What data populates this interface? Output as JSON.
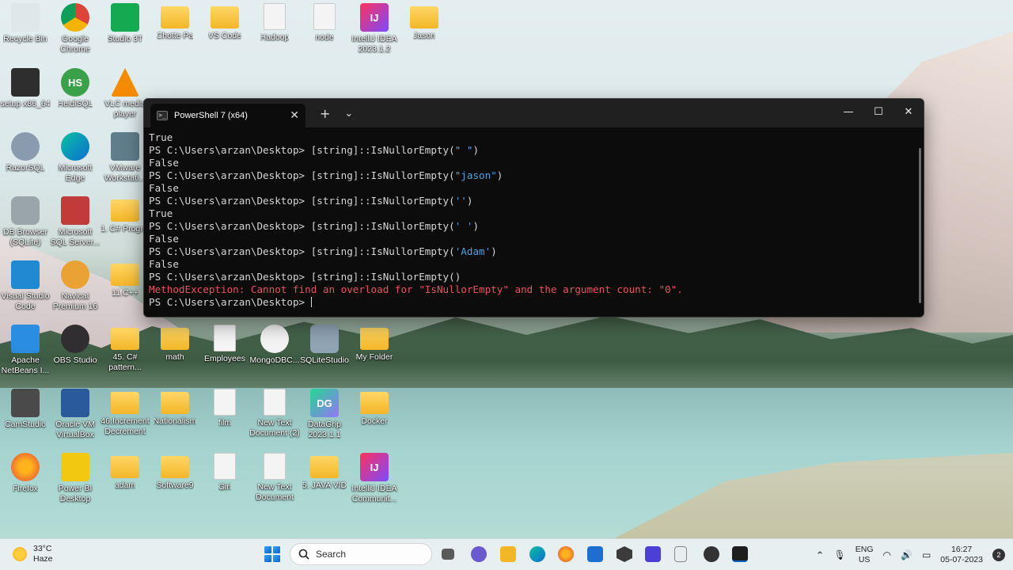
{
  "desktop": {
    "icons": [
      {
        "label": "Recycle Bin",
        "icon": "recycle-bin-icon"
      },
      {
        "label": "Google Chrome",
        "icon": "chrome-icon"
      },
      {
        "label": "Studio 3T",
        "icon": "studio3t-icon"
      },
      {
        "label": "Chotte Pa",
        "icon": "folder-icon"
      },
      {
        "label": "VS Code",
        "icon": "folder-icon"
      },
      {
        "label": "Hadoop",
        "icon": "document-icon"
      },
      {
        "label": "node",
        "icon": "document-icon"
      },
      {
        "label": "IntelliJ IDEA 2023.1.2",
        "icon": "intellij-icon"
      },
      {
        "label": "Jason",
        "icon": "folder-icon"
      },
      {
        "label": "setup x86_64",
        "icon": "setup-icon"
      },
      {
        "label": "HeidiSQL",
        "icon": "heidisql-icon"
      },
      {
        "label": "VLC media player",
        "icon": "vlc-icon"
      },
      {
        "label": "RazorSQL",
        "icon": "razorsql-icon"
      },
      {
        "label": "Microsoft Edge",
        "icon": "edge-icon"
      },
      {
        "label": "VMware Workstati...",
        "icon": "vmware-icon"
      },
      {
        "label": "DB Browser (SQLite)",
        "icon": "database-icon"
      },
      {
        "label": "Microsoft SQL Server...",
        "icon": "sqlserver-icon"
      },
      {
        "label": "1. C# Progr...",
        "icon": "folder-icon"
      },
      {
        "label": "Visual Studio Code",
        "icon": "vscode-icon"
      },
      {
        "label": "Navicat Premium 16",
        "icon": "navicat-icon"
      },
      {
        "label": "11.C++",
        "icon": "folder-icon"
      },
      {
        "label": "Apache NetBeans I...",
        "icon": "netbeans-icon"
      },
      {
        "label": "OBS Studio",
        "icon": "obs-icon"
      },
      {
        "label": "45. C# pattern...",
        "icon": "folder-icon"
      },
      {
        "label": "math",
        "icon": "folder-icon"
      },
      {
        "label": "Employees",
        "icon": "document-icon"
      },
      {
        "label": "MongoDBC...",
        "icon": "mongodb-icon"
      },
      {
        "label": "SQLiteStudio",
        "icon": "sqlitestudio-icon"
      },
      {
        "label": "My Folder",
        "icon": "folder-icon"
      },
      {
        "label": "CamStudio",
        "icon": "camstudio-icon"
      },
      {
        "label": "Oracle VM VirtualBox",
        "icon": "virtualbox-icon"
      },
      {
        "label": "46.Increment Decrement",
        "icon": "folder-icon"
      },
      {
        "label": "Nationalism",
        "icon": "folder-icon"
      },
      {
        "label": "film",
        "icon": "document-icon"
      },
      {
        "label": "New Text Document (2)",
        "icon": "document-icon"
      },
      {
        "label": "DataGrip 2023.1.1",
        "icon": "datagrip-icon"
      },
      {
        "label": "Docker",
        "icon": "folder-icon"
      },
      {
        "label": "Firefox",
        "icon": "firefox-icon"
      },
      {
        "label": "Power BI Desktop",
        "icon": "powerbi-icon"
      },
      {
        "label": "adam",
        "icon": "folder-icon"
      },
      {
        "label": "Software9",
        "icon": "folder-icon"
      },
      {
        "label": "Girl",
        "icon": "document-icon"
      },
      {
        "label": "New Text Document",
        "icon": "document-icon"
      },
      {
        "label": "5. JAVA VID",
        "icon": "folder-icon"
      },
      {
        "label": "IntelliJ IDEA Communit...",
        "icon": "intellij-icon"
      }
    ],
    "row2_extra": [
      "",
      "",
      "",
      "",
      ""
    ]
  },
  "terminal": {
    "tab_title": "PowerShell 7 (x64)",
    "new_tab": "+",
    "dropdown": "⌄",
    "minimize": "—",
    "maximize": "☐",
    "close": "✕",
    "lines": [
      {
        "kind": "out",
        "text": "True"
      },
      {
        "kind": "cmd",
        "prompt": "PS C:\\Users\\arzan\\Desktop> ",
        "code": "[string]::IsNullorEmpty(",
        "arg": "\" \"",
        "tail": ")"
      },
      {
        "kind": "out",
        "text": "False"
      },
      {
        "kind": "cmd",
        "prompt": "PS C:\\Users\\arzan\\Desktop> ",
        "code": "[string]::IsNullorEmpty(",
        "arg": "\"jason\"",
        "tail": ")"
      },
      {
        "kind": "out",
        "text": "False"
      },
      {
        "kind": "cmd",
        "prompt": "PS C:\\Users\\arzan\\Desktop> ",
        "code": "[string]::IsNullorEmpty(",
        "arg": "''",
        "tail": ")"
      },
      {
        "kind": "out",
        "text": "True"
      },
      {
        "kind": "cmd",
        "prompt": "PS C:\\Users\\arzan\\Desktop> ",
        "code": "[string]::IsNullorEmpty(",
        "arg": "' '",
        "tail": ")"
      },
      {
        "kind": "out",
        "text": "False"
      },
      {
        "kind": "cmd",
        "prompt": "PS C:\\Users\\arzan\\Desktop> ",
        "code": "[string]::IsNullorEmpty(",
        "arg": "'Adam'",
        "tail": ")"
      },
      {
        "kind": "out",
        "text": "False"
      },
      {
        "kind": "cmd",
        "prompt": "PS C:\\Users\\arzan\\Desktop> ",
        "code": "[string]::IsNullorEmpty()",
        "arg": "",
        "tail": ""
      },
      {
        "kind": "err",
        "text": "MethodException: Cannot find an overload for \"IsNullorEmpty\" and the argument count: \"0\"."
      },
      {
        "kind": "prompt",
        "text": "PS C:\\Users\\arzan\\Desktop> "
      }
    ]
  },
  "taskbar": {
    "weather_temp": "33°C",
    "weather_desc": "Haze",
    "search_placeholder": "Search",
    "lang_top": "ENG",
    "lang_bottom": "US",
    "time": "16:27",
    "date": "05-07-2023",
    "notification_count": "2"
  },
  "colors": {
    "console_bg": "#0c0c0c",
    "string_color": "#4ea1e0",
    "error_color": "#e8515f"
  }
}
